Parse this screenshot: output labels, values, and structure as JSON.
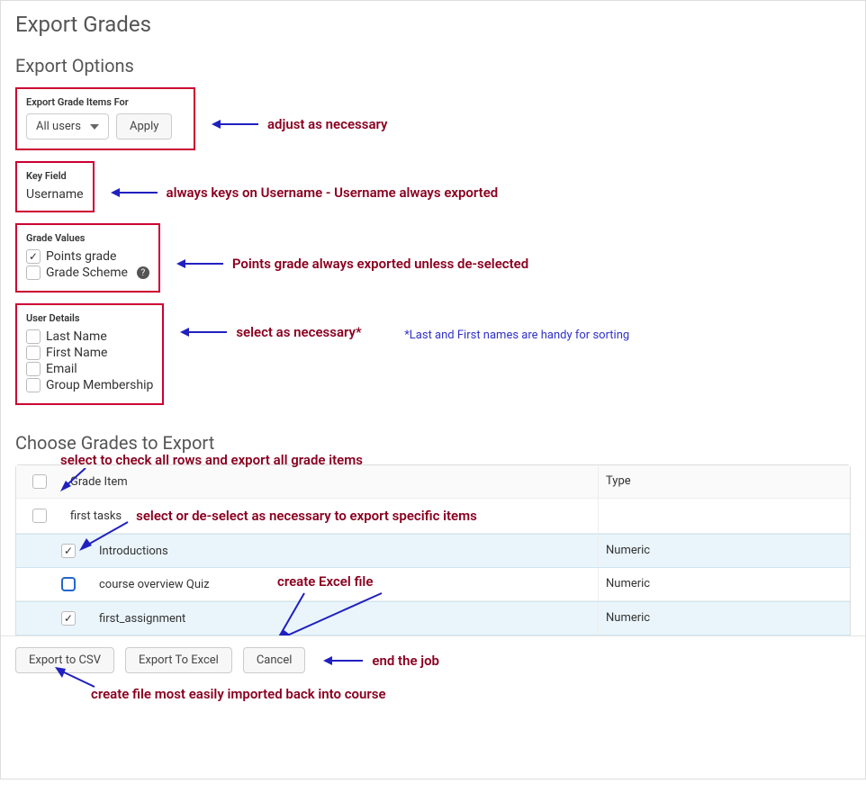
{
  "page_title": "Export Grades",
  "export_options_title": "Export Options",
  "export_items_for": {
    "label": "Export Grade Items For",
    "selected": "All users",
    "apply": "Apply"
  },
  "key_field": {
    "label": "Key Field",
    "value": "Username"
  },
  "grade_values": {
    "label": "Grade Values",
    "options": [
      {
        "label": "Points grade",
        "checked": true
      },
      {
        "label": "Grade Scheme",
        "checked": false,
        "help": true
      }
    ]
  },
  "user_details": {
    "label": "User Details",
    "options": [
      {
        "label": "Last Name",
        "checked": false
      },
      {
        "label": "First Name",
        "checked": false
      },
      {
        "label": "Email",
        "checked": false
      },
      {
        "label": "Group Membership",
        "checked": false
      }
    ]
  },
  "choose_grades_title": "Choose Grades to Export",
  "table": {
    "header_item": "Grade Item",
    "header_type": "Type",
    "rows": [
      {
        "name": "first tasks",
        "type": "",
        "checked": false,
        "indent": false,
        "selected": false,
        "blue": false
      },
      {
        "name": "Introductions",
        "type": "Numeric",
        "checked": true,
        "indent": true,
        "selected": true,
        "blue": false
      },
      {
        "name": "course overview Quiz",
        "type": "Numeric",
        "checked": false,
        "indent": true,
        "selected": false,
        "blue": true
      },
      {
        "name": "first_assignment",
        "type": "Numeric",
        "checked": true,
        "indent": true,
        "selected": true,
        "blue": false
      }
    ]
  },
  "footer": {
    "export_csv": "Export to CSV",
    "export_excel": "Export To Excel",
    "cancel": "Cancel"
  },
  "annotations": {
    "a1": "adjust as necessary",
    "a2": "always keys on Username - Username always exported",
    "a3": "Points grade always exported unless de-selected",
    "a4": "select as necessary*",
    "a4_sub": "*Last and First names are handy for sorting",
    "a5": "select to check all rows and export all grade items",
    "a6": "select or de-select as necessary to export specific items",
    "a7": "create Excel file",
    "a8": "end the job",
    "a9": "create file most easily imported back into course"
  }
}
